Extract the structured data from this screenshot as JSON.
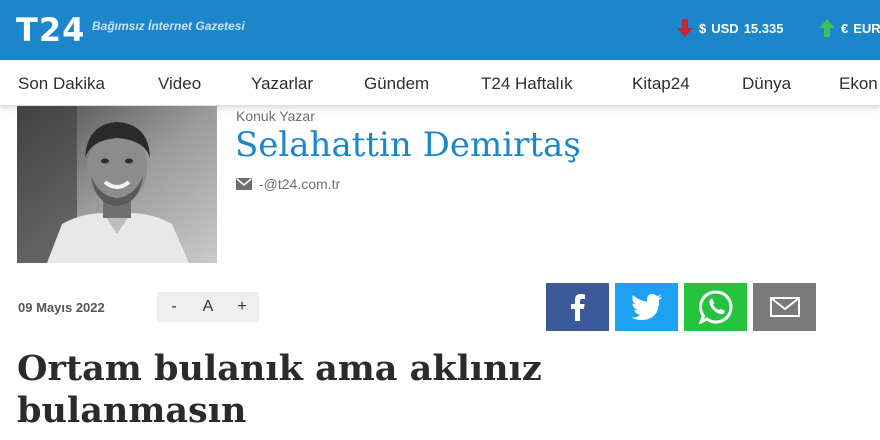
{
  "header": {
    "logo": "T24",
    "tagline": "Bağımsız İnternet Gazetesi",
    "currencies": [
      {
        "symbol": "$",
        "code": "USD",
        "value": "15.335",
        "trend": "down",
        "color": "#c0283a"
      },
      {
        "symbol": "€",
        "code": "EUR",
        "value": "",
        "trend": "up",
        "color": "#3fbf5a"
      }
    ]
  },
  "nav": {
    "items": [
      "Son Dakika",
      "Video",
      "Yazarlar",
      "Gündem",
      "T24 Haftalık",
      "Kitap24",
      "Dünya",
      "Ekon"
    ]
  },
  "author": {
    "role": "Konuk Yazar",
    "name": "Selahattin Demirtaş",
    "email": "-@t24.com.tr"
  },
  "article": {
    "date": "09 Mayıs 2022",
    "font_controls": {
      "decrease": "-",
      "reset": "A",
      "increase": "+"
    },
    "title": "Ortam bulanık ama aklınız bulanmasın"
  },
  "share": {
    "facebook_color": "#3b5998",
    "twitter_color": "#1da1f2",
    "whatsapp_color": "#25c33f",
    "mail_color": "#7a7a7a"
  },
  "colors": {
    "brand": "#1b86c9"
  }
}
